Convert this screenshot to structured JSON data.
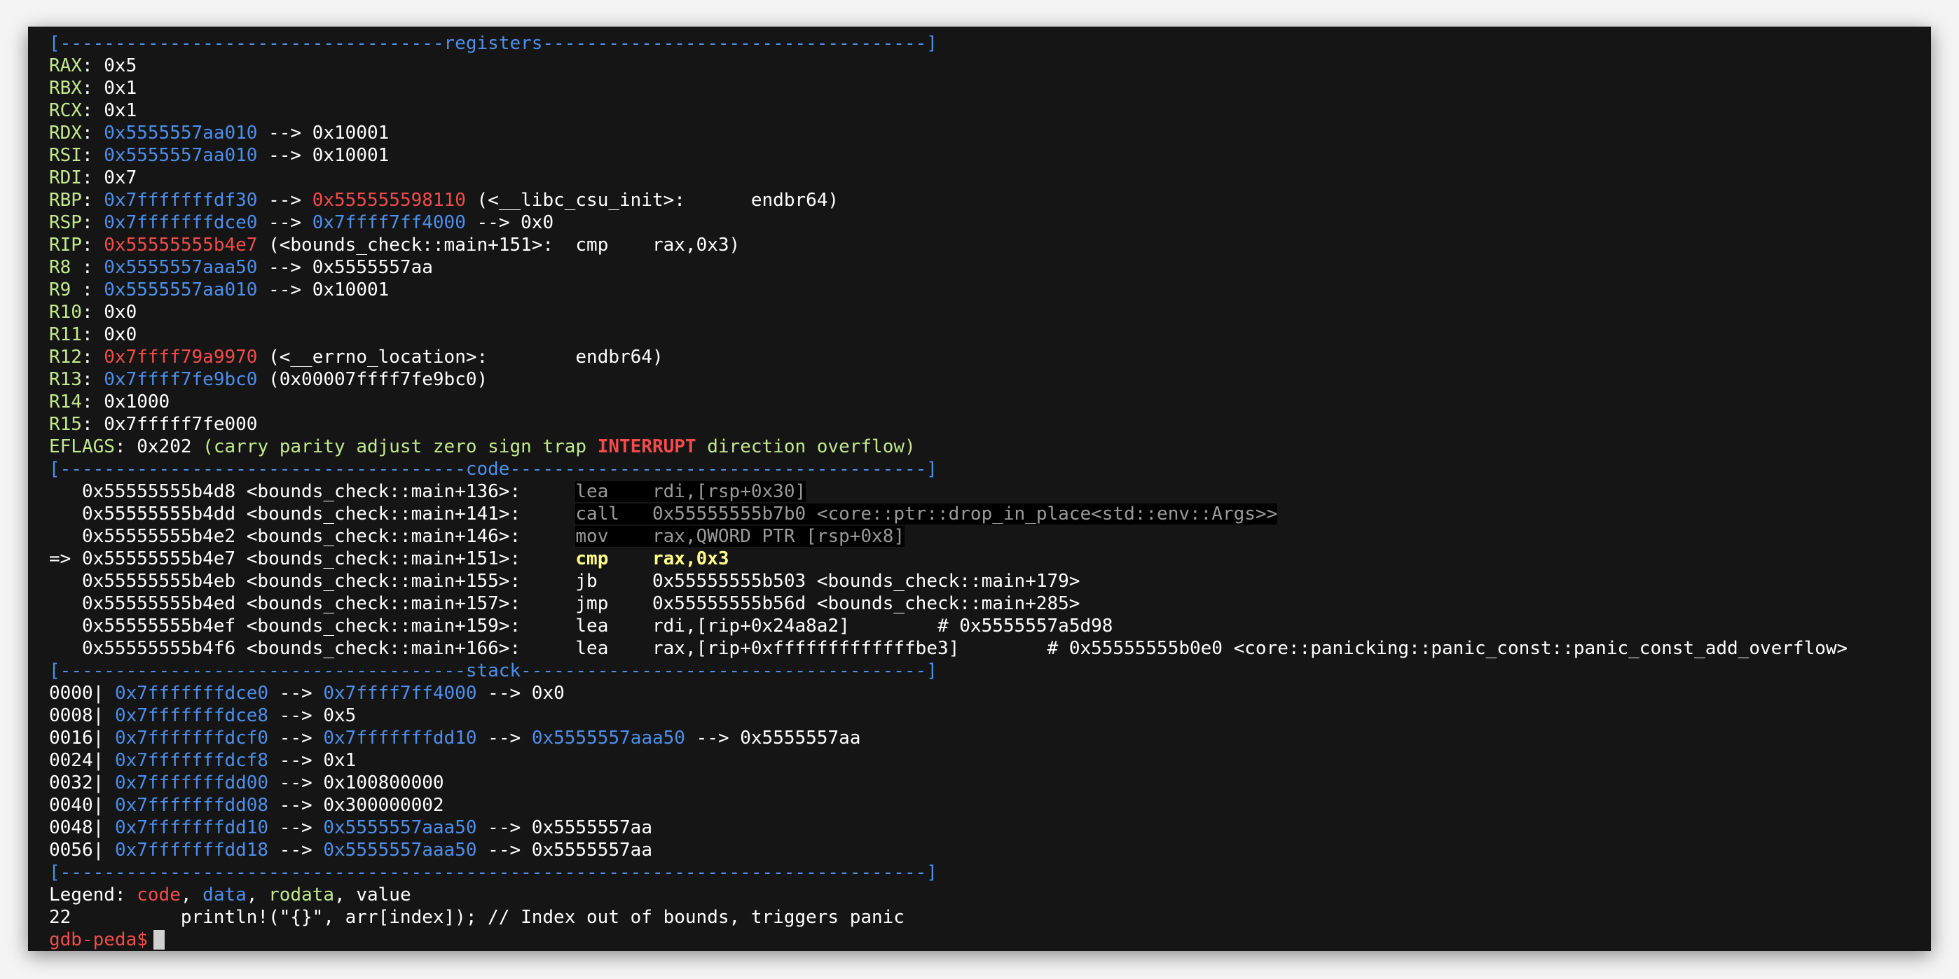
{
  "separators": {
    "registers": "[-----------------------------------registers-----------------------------------]",
    "code": "[-------------------------------------code--------------------------------------]",
    "stack": "[-------------------------------------stack-------------------------------------]",
    "end": "[-------------------------------------------------------------------------------]"
  },
  "registers": [
    {
      "name": "RAX",
      "segments": [
        {
          "t": "0x5",
          "c": "w"
        }
      ]
    },
    {
      "name": "RBX",
      "segments": [
        {
          "t": "0x1",
          "c": "w"
        }
      ]
    },
    {
      "name": "RCX",
      "segments": [
        {
          "t": "0x1",
          "c": "w"
        }
      ]
    },
    {
      "name": "RDX",
      "segments": [
        {
          "t": "0x5555557aa010",
          "c": "b"
        },
        {
          "t": " --> 0x10001",
          "c": "w"
        }
      ]
    },
    {
      "name": "RSI",
      "segments": [
        {
          "t": "0x5555557aa010",
          "c": "b"
        },
        {
          "t": " --> 0x10001",
          "c": "w"
        }
      ]
    },
    {
      "name": "RDI",
      "segments": [
        {
          "t": "0x7",
          "c": "w"
        }
      ]
    },
    {
      "name": "RBP",
      "segments": [
        {
          "t": "0x7fffffffdf30",
          "c": "b"
        },
        {
          "t": " --> ",
          "c": "w"
        },
        {
          "t": "0x555555598110",
          "c": "r"
        },
        {
          "t": " (<__libc_csu_init>:      endbr64)",
          "c": "w"
        }
      ]
    },
    {
      "name": "RSP",
      "segments": [
        {
          "t": "0x7fffffffdce0",
          "c": "b"
        },
        {
          "t": " --> ",
          "c": "w"
        },
        {
          "t": "0x7ffff7ff4000",
          "c": "b"
        },
        {
          "t": " --> 0x0",
          "c": "w"
        }
      ]
    },
    {
      "name": "RIP",
      "segments": [
        {
          "t": "0x55555555b4e7",
          "c": "r"
        },
        {
          "t": " (<bounds_check::main+151>:  cmp    rax,0x3)",
          "c": "w"
        }
      ]
    },
    {
      "name": "R8 ",
      "segments": [
        {
          "t": "0x5555557aaa50",
          "c": "b"
        },
        {
          "t": " --> 0x5555557aa",
          "c": "w"
        }
      ]
    },
    {
      "name": "R9 ",
      "segments": [
        {
          "t": "0x5555557aa010",
          "c": "b"
        },
        {
          "t": " --> 0x10001",
          "c": "w"
        }
      ]
    },
    {
      "name": "R10",
      "segments": [
        {
          "t": "0x0",
          "c": "w"
        }
      ]
    },
    {
      "name": "R11",
      "segments": [
        {
          "t": "0x0",
          "c": "w"
        }
      ]
    },
    {
      "name": "R12",
      "segments": [
        {
          "t": "0x7ffff79a9970",
          "c": "r"
        },
        {
          "t": " (<__errno_location>:        endbr64)",
          "c": "w"
        }
      ]
    },
    {
      "name": "R13",
      "segments": [
        {
          "t": "0x7ffff7fe9bc0",
          "c": "b"
        },
        {
          "t": " (0x00007ffff7fe9bc0)",
          "c": "w"
        }
      ]
    },
    {
      "name": "R14",
      "segments": [
        {
          "t": "0x1000",
          "c": "w"
        }
      ]
    },
    {
      "name": "R15",
      "segments": [
        {
          "t": "0x7fffff7fe000",
          "c": "w"
        }
      ]
    }
  ],
  "eflags": {
    "name": "EFLAGS",
    "value": "0x202",
    "flags_before": "(carry parity adjust zero sign trap ",
    "interrupt": "INTERRUPT",
    "flags_after": " direction overflow)"
  },
  "code": [
    {
      "prefix": "   ",
      "addr": "0x55555555b4d8 <bounds_check::main+136>:",
      "mnem": "lea ",
      "ops": "rdi,[rsp+0x30]",
      "comment": "",
      "style": "prev"
    },
    {
      "prefix": "   ",
      "addr": "0x55555555b4dd <bounds_check::main+141>:",
      "mnem": "call",
      "ops": "0x55555555b7b0 <core::ptr::drop_in_place<std::env::Args>>",
      "comment": "",
      "style": "prev"
    },
    {
      "prefix": "   ",
      "addr": "0x55555555b4e2 <bounds_check::main+146>:",
      "mnem": "mov ",
      "ops": "rax,QWORD PTR [rsp+0x8]",
      "comment": "",
      "style": "prev"
    },
    {
      "prefix": "=> ",
      "addr": "0x55555555b4e7 <bounds_check::main+151>:",
      "mnem": "cmp ",
      "ops": "rax,0x3",
      "comment": "",
      "style": "cur"
    },
    {
      "prefix": "   ",
      "addr": "0x55555555b4eb <bounds_check::main+155>:",
      "mnem": "jb  ",
      "ops": "0x55555555b503 <bounds_check::main+179>",
      "comment": "",
      "style": "next"
    },
    {
      "prefix": "   ",
      "addr": "0x55555555b4ed <bounds_check::main+157>:",
      "mnem": "jmp ",
      "ops": "0x55555555b56d <bounds_check::main+285>",
      "comment": "",
      "style": "next"
    },
    {
      "prefix": "   ",
      "addr": "0x55555555b4ef <bounds_check::main+159>:",
      "mnem": "lea ",
      "ops": "rdi,[rip+0x24a8a2]",
      "comment": "        # 0x5555557a5d98",
      "style": "next"
    },
    {
      "prefix": "   ",
      "addr": "0x55555555b4f6 <bounds_check::main+166>:",
      "mnem": "lea ",
      "ops": "rax,[rip+0xfffffffffffffbe3]",
      "comment": "        # 0x55555555b0e0 <core::panicking::panic_const::panic_const_add_overflow>",
      "style": "next"
    }
  ],
  "stack": [
    {
      "off": "0000",
      "segments": [
        {
          "t": "0x7fffffffdce0",
          "c": "b"
        },
        {
          "t": " --> ",
          "c": "w"
        },
        {
          "t": "0x7ffff7ff4000",
          "c": "b"
        },
        {
          "t": " --> 0x0",
          "c": "w"
        }
      ]
    },
    {
      "off": "0008",
      "segments": [
        {
          "t": "0x7fffffffdce8",
          "c": "b"
        },
        {
          "t": " --> 0x5",
          "c": "w"
        }
      ]
    },
    {
      "off": "0016",
      "segments": [
        {
          "t": "0x7fffffffdcf0",
          "c": "b"
        },
        {
          "t": " --> ",
          "c": "w"
        },
        {
          "t": "0x7fffffffdd10",
          "c": "b"
        },
        {
          "t": " --> ",
          "c": "w"
        },
        {
          "t": "0x5555557aaa50",
          "c": "b"
        },
        {
          "t": " --> 0x5555557aa",
          "c": "w"
        }
      ]
    },
    {
      "off": "0024",
      "segments": [
        {
          "t": "0x7fffffffdcf8",
          "c": "b"
        },
        {
          "t": " --> 0x1",
          "c": "w"
        }
      ]
    },
    {
      "off": "0032",
      "segments": [
        {
          "t": "0x7fffffffdd00",
          "c": "b"
        },
        {
          "t": " --> 0x100800000",
          "c": "w"
        }
      ]
    },
    {
      "off": "0040",
      "segments": [
        {
          "t": "0x7fffffffdd08",
          "c": "b"
        },
        {
          "t": " --> 0x300000002",
          "c": "w"
        }
      ]
    },
    {
      "off": "0048",
      "segments": [
        {
          "t": "0x7fffffffdd10",
          "c": "b"
        },
        {
          "t": " --> ",
          "c": "w"
        },
        {
          "t": "0x5555557aaa50",
          "c": "b"
        },
        {
          "t": " --> 0x5555557aa",
          "c": "w"
        }
      ]
    },
    {
      "off": "0056",
      "segments": [
        {
          "t": "0x7fffffffdd18",
          "c": "b"
        },
        {
          "t": " --> ",
          "c": "w"
        },
        {
          "t": "0x5555557aaa50",
          "c": "b"
        },
        {
          "t": " --> 0x5555557aa",
          "c": "w"
        }
      ]
    }
  ],
  "legend": {
    "label": "Legend: ",
    "code": "code",
    "sep1": ", ",
    "data": "data",
    "sep2": ", ",
    "rodata": "rodata",
    "sep3": ", ",
    "value": "value"
  },
  "source_line": {
    "lineno": "22",
    "text": "          println!(\"{}\", arr[index]); // Index out of bounds, triggers panic"
  },
  "prompt": "gdb-peda$",
  "colors": {
    "background": "#151515",
    "blue": "#4d8fec",
    "green": "#c3e88d",
    "red": "#f24b4b",
    "yellow": "#fffd88"
  }
}
